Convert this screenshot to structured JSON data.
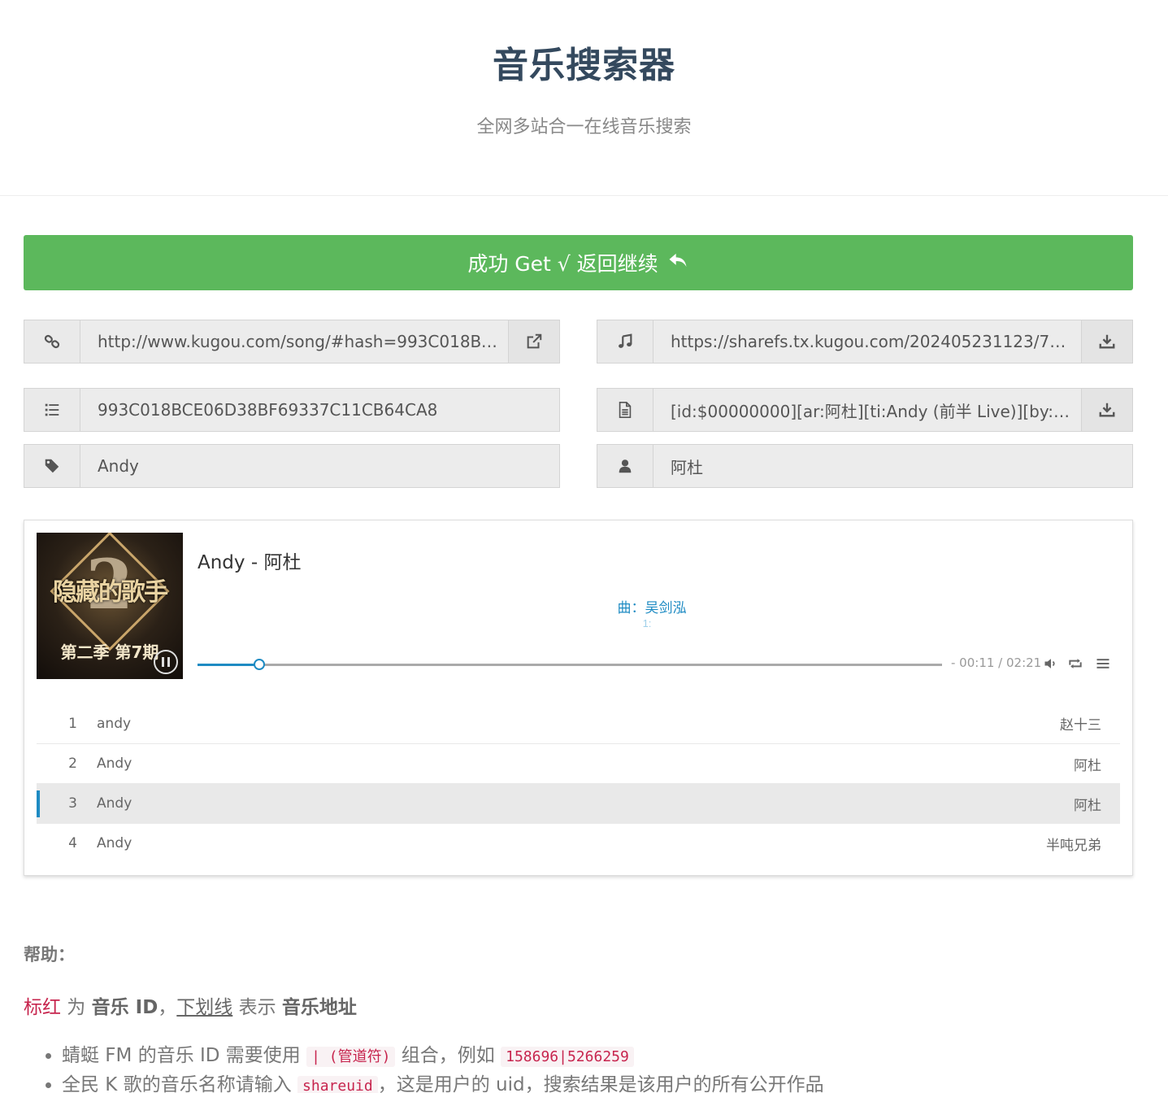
{
  "header": {
    "title": "音乐搜索器",
    "subtitle": "全网多站合一在线音乐搜索"
  },
  "success_button": {
    "label": "成功 Get √ 返回继续",
    "icon": "reply-icon",
    "color": "#5cb85c"
  },
  "fields": {
    "link": {
      "icon": "link-icon",
      "value": "http://www.kugou.com/song/#hash=993C018BCE...",
      "action_icon": "external-link-icon"
    },
    "url": {
      "icon": "music-icon",
      "value": "https://sharefs.tx.kugou.com/202405231123/77e6f...",
      "action_icon": "download-icon"
    },
    "id": {
      "icon": "list-icon",
      "value": "993C018BCE06D38BF69337C11CB64CA8"
    },
    "lrc": {
      "icon": "file-icon",
      "value": "[id:$00000000][ar:阿杜][ti:Andy (前半 Live)][by:][ha...",
      "action_icon": "download-icon"
    },
    "title": {
      "icon": "tag-icon",
      "value": "Andy"
    },
    "author": {
      "icon": "user-icon",
      "value": "阿杜"
    }
  },
  "player": {
    "cover": {
      "number": "2",
      "show_name": "隐藏的歌手",
      "episode": "第二季 第7期"
    },
    "song_title": "Andy - 阿杜",
    "lyric_current": "曲：吴剑泓",
    "lyric_next": "1:",
    "progress_fraction": 0.083,
    "time": "- 00:11 / 02:21",
    "accent_color": "#1e8bc3",
    "controls": [
      "volume-icon",
      "loop-icon",
      "menu-icon"
    ],
    "playlist": [
      {
        "index": "1",
        "name": "andy",
        "artist": "赵十三"
      },
      {
        "index": "2",
        "name": "Andy",
        "artist": "阿杜"
      },
      {
        "index": "3",
        "name": "Andy",
        "artist": "阿杜",
        "active": true
      },
      {
        "index": "4",
        "name": "Andy",
        "artist": "半吨兄弟"
      }
    ]
  },
  "help": {
    "title": "帮助：",
    "legend": {
      "red": "标红",
      "t1": " 为 ",
      "b1": "音乐 ID",
      "t2": "，",
      "u1": "下划线",
      "t3": " 表示 ",
      "b2": "音乐地址"
    },
    "items": [
      {
        "t1": "蜻蜓 FM 的音乐 ID 需要使用 ",
        "c1": "| (管道符)",
        "t2": " 组合，例如 ",
        "c2": "158696|5266259",
        "t3": ""
      },
      {
        "t1": "全民 K 歌的音乐名称请输入 ",
        "c1": "shareuid",
        "t2": "，这是用户的 uid，搜索结果是该用户的所有公开作品",
        "c2": "",
        "t3": ""
      }
    ]
  }
}
